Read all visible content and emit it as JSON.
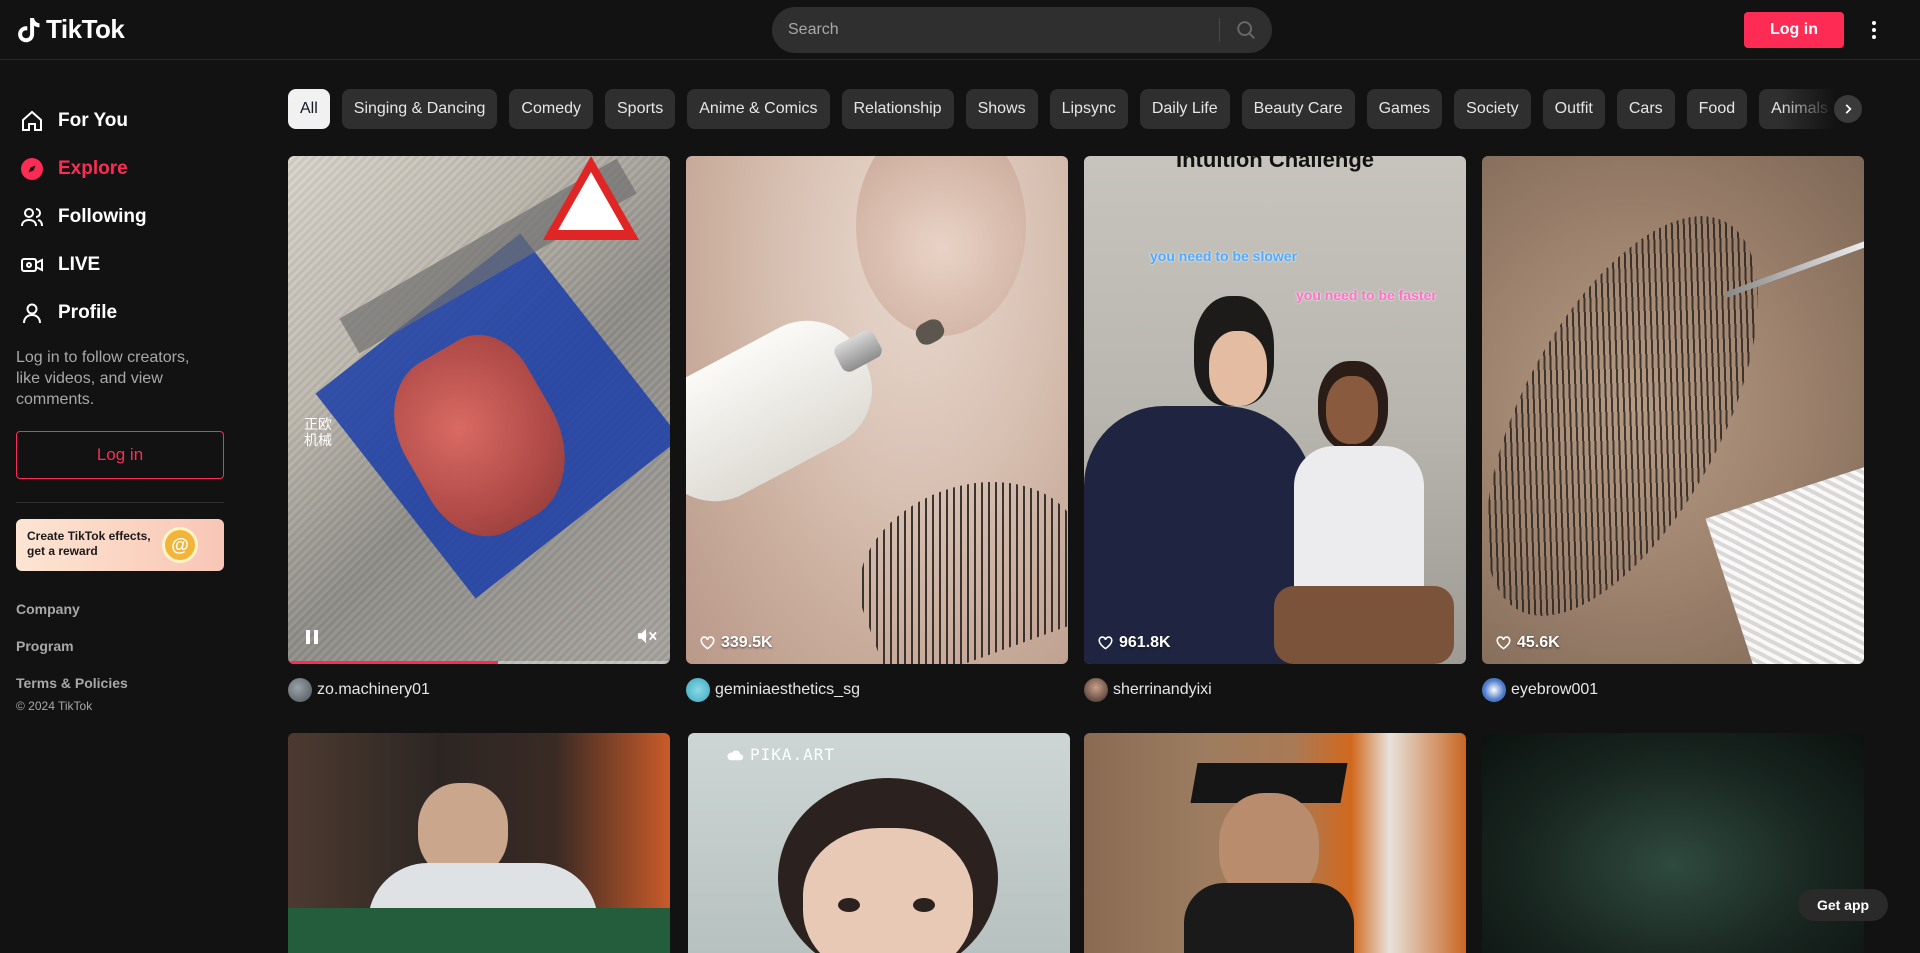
{
  "header": {
    "logo_text": "TikTok",
    "search_placeholder": "Search",
    "login_label": "Log in"
  },
  "sidebar": {
    "items": [
      {
        "label": "For You",
        "icon": "home-icon"
      },
      {
        "label": "Explore",
        "icon": "compass-icon",
        "active": true
      },
      {
        "label": "Following",
        "icon": "users-icon"
      },
      {
        "label": "LIVE",
        "icon": "live-icon"
      },
      {
        "label": "Profile",
        "icon": "user-icon"
      }
    ],
    "login_prompt": "Log in to follow creators, like videos, and view comments.",
    "login_label": "Log in",
    "effects_banner": "Create TikTok effects, get a reward",
    "footer_links": [
      "Company",
      "Program",
      "Terms & Policies"
    ],
    "copyright": "© 2024 TikTok"
  },
  "categories": {
    "chips": [
      "All",
      "Singing & Dancing",
      "Comedy",
      "Sports",
      "Anime & Comics",
      "Relationship",
      "Shows",
      "Lipsync",
      "Daily Life",
      "Beauty Care",
      "Games",
      "Society",
      "Outfit",
      "Cars",
      "Food",
      "Animals"
    ],
    "selected": "All"
  },
  "videos": [
    {
      "author": "zo.machinery01",
      "likes": "",
      "playing": true,
      "progress": 0.55,
      "overlay_text": "正欧\n机械"
    },
    {
      "author": "geminiaesthetics_sg",
      "likes": "339.5K"
    },
    {
      "author": "sherrinandyixi",
      "likes": "961.8K",
      "overlay_title": "Intuition Challenge",
      "caption_1": "you need to be slower",
      "caption_2": "you need to be faster"
    },
    {
      "author": "eyebrow001",
      "likes": "45.6K"
    }
  ],
  "second_row": [
    {
      "watermark": ""
    },
    {
      "watermark": "PIKA.ART"
    },
    {
      "watermark": ""
    },
    {
      "watermark": ""
    }
  ],
  "get_app_label": "Get app",
  "colors": {
    "accent": "#fe2c55",
    "background": "#121212",
    "chip": "#2f2f2f"
  }
}
